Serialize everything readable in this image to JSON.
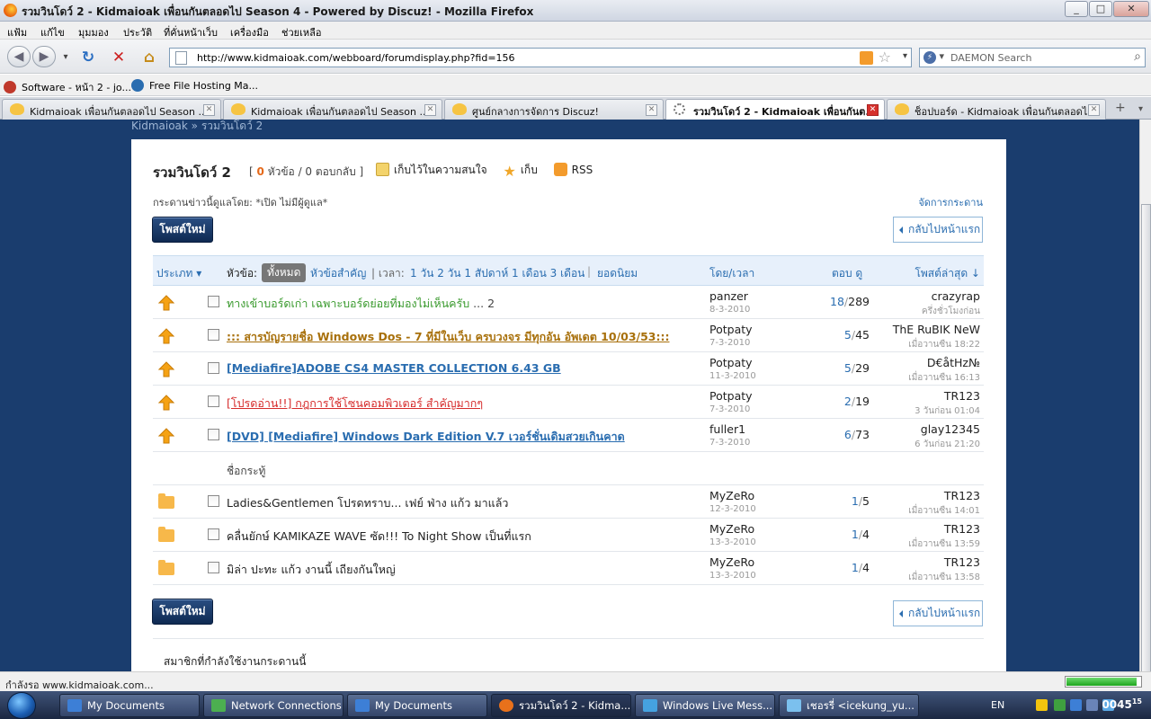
{
  "window": {
    "title": "รวมวินโดว์ 2 - Kidmaioak เพื่อนกันตลอดไป Season 4 - Powered by Discuz! - Mozilla Firefox",
    "min_label": "_",
    "max_label": "□",
    "close_label": "✕"
  },
  "menu": [
    "แฟ้ม",
    "แก้ไข",
    "มุมมอง",
    "ประวัติ",
    "ที่คั่นหน้าเว็บ",
    "เครื่องมือ",
    "ช่วยเหลือ"
  ],
  "nav": {
    "back_label": "◀",
    "forward_label": "▶",
    "dropdown_label": "▾",
    "reload_label": "↻",
    "stop_label": "✕",
    "home_label": "⌂",
    "url": "http://www.kidmaioak.com/webboard/forumdisplay.php?fid=156",
    "search_placeholder": "DAEMON Search"
  },
  "bookmarks": [
    {
      "label": "Software - หน้า 2 - jo...",
      "icon": "red-circle-icon",
      "color": "#c0392b"
    },
    {
      "label": "Free File Hosting Ma...",
      "icon": "flame-icon",
      "color": "#2a6db0"
    }
  ],
  "tabs": [
    {
      "label": "Kidmaioak เพื่อนกันตลอดไป Season ...",
      "active": false
    },
    {
      "label": "Kidmaioak เพื่อนกันตลอดไป Season ...",
      "active": false
    },
    {
      "label": "ศูนย์กลางการจัดการ Discuz!",
      "active": false
    },
    {
      "label": "รวมวินโดว์ 2 - Kidmaioak เพื่อนกันต...",
      "active": true
    },
    {
      "label": "ช็อปบอร์ด - Kidmaioak เพื่อนกันตลอดไ...",
      "active": false
    }
  ],
  "breadcrumb": "Kidmaioak » รวมวินโดว์ 2",
  "forum": {
    "title": "รวมวินโดว์ 2",
    "stats_open": "[",
    "stats_topics_num": "0",
    "stats_text": "หัวข้อ / 0 ตอบกลับ ]",
    "action_favorite": "เก็บไว้ในความสนใจ",
    "action_keep": "เก็บ",
    "action_rss": "RSS",
    "moderators": "กระดานข่าวนี้ดูแลโดย: *เปิด ไม่มีผู้ดูแล*",
    "manage_link": "จัดการกระดาน",
    "post_new_label": "โพสต์ใหม่",
    "back_home_label": "กลับไปหน้าแรก"
  },
  "table_header": {
    "type": "ประเภท ▾",
    "topic_label": "หัวข้อ:",
    "all": "ทั้งหมด",
    "important": "หัวข้อสำคัญ",
    "time_sep": "| เวลา:",
    "time_filters": "1 วัน 2 วัน 1 สัปดาห์ 1 เดือน 3 เดือน",
    "popular_sep": "|",
    "popular": "ยอดนิยม",
    "author_time": "โดย/เวลา",
    "replies_views": "ตอบ ดู",
    "last_post": "โพสต์ล่าสุด ↓"
  },
  "sticky_topics": [
    {
      "subject": "ทางเข้าบอร์ดเก่า เฉพาะบอร์ดย่อยที่มองไม่เห็นครับ",
      "pages": "... 2",
      "color": "#3a9a2e",
      "bold": false,
      "underline": false,
      "author": "panzer",
      "date": "8-3-2010",
      "replies": "18",
      "views": "289",
      "last_user": "crazyrap",
      "last_time": "ครึ่งชั่วโมงก่อน"
    },
    {
      "subject": "::: สารบัญรายชื่อ Windows Dos - 7 ที่มีในเว็บ ครบวงจร มีทุกอัน อัพเดต 10/03/53:::",
      "pages": "",
      "color": "#a8700b",
      "bold": true,
      "underline": true,
      "author": "Potpaty",
      "date": "7-3-2010",
      "replies": "5",
      "views": "45",
      "last_user": "ThE RuBIK NeW",
      "last_time": "เมื่อวานซืน 18:22"
    },
    {
      "subject": "[Mediafire]ADOBE CS4 MASTER COLLECTION 6.43 GB",
      "pages": "",
      "color": "#2a6db0",
      "bold": true,
      "underline": true,
      "author": "Potpaty",
      "date": "11-3-2010",
      "replies": "5",
      "views": "29",
      "last_user": "D€åtHz№",
      "last_time": "เมื่อวานซืน 16:13"
    },
    {
      "subject": "[โปรดอ่าน!!] กฎการใช้โซนคอมพิวเตอร์ สำคัญมากๆ",
      "pages": "",
      "color": "#d62b2b",
      "bold": false,
      "underline": true,
      "author": "Potpaty",
      "date": "7-3-2010",
      "replies": "2",
      "views": "19",
      "last_user": "TR123",
      "last_time": "3 วันก่อน 01:04"
    },
    {
      "subject": "[DVD] [Mediafire] Windows Dark Edition V.7 เวอร์ชั่นเดิมสวยเกินคาด",
      "pages": "",
      "color": "#2a6db0",
      "bold": true,
      "underline": true,
      "author": "fuller1",
      "date": "7-3-2010",
      "replies": "6",
      "views": "73",
      "last_user": "glay12345",
      "last_time": "6 วันก่อน 21:20"
    }
  ],
  "separator_label": "ชื่อกระทู้",
  "normal_topics": [
    {
      "subject": "Ladies&Gentlemen โปรดทราบ... เฟย์ ฟ่าง แก้ว มาแล้ว",
      "author": "MyZeRo",
      "date": "12-3-2010",
      "replies": "1",
      "views": "5",
      "last_user": "TR123",
      "last_time": "เมื่อวานซืน 14:01"
    },
    {
      "subject": "คลื่นยักษ์ KAMIKAZE WAVE ซัด!!! To Night Show เป็นที่แรก",
      "author": "MyZeRo",
      "date": "13-3-2010",
      "replies": "1",
      "views": "4",
      "last_user": "TR123",
      "last_time": "เมื่อวานซืน 13:59"
    },
    {
      "subject": "มิล่า ปะทะ แก้ว งานนี้ เถียงกันใหญ่",
      "author": "MyZeRo",
      "date": "13-3-2010",
      "replies": "1",
      "views": "4",
      "last_user": "TR123",
      "last_time": "เมื่อวานซืน 13:58"
    }
  ],
  "online_title": "สมาชิกที่กำลังใช้งานกระดานนี้",
  "status": {
    "text": "กำลังรอ www.kidmaioak.com...",
    "progress": 0.95
  },
  "taskbar": {
    "items": [
      {
        "label": "My Documents",
        "icon": "folder-icon",
        "color": "#3d7fd6",
        "active": false
      },
      {
        "label": "Network Connections",
        "icon": "network-icon",
        "color": "#4caf50",
        "active": false
      },
      {
        "label": "My Documents",
        "icon": "folder-icon",
        "color": "#3d7fd6",
        "active": false
      },
      {
        "label": "รวมวินโดว์ 2 - Kidma...",
        "icon": "firefox-icon",
        "color": "#e8711b",
        "active": true
      },
      {
        "label": "Windows Live Mess...",
        "icon": "messenger-icon",
        "color": "#45a2e0",
        "active": false
      },
      {
        "label": "เชอรรี่ <icekung_yu...",
        "icon": "chat-icon",
        "color": "#7bc0ee",
        "active": false
      }
    ],
    "lang": "EN",
    "clock_hm": "00",
    "clock_m": "45",
    "clock_s": "15"
  },
  "colors": {
    "accent": "#2a6db0",
    "page_bg": "#1a3d6e",
    "highlight_orange": "#e5691a"
  }
}
